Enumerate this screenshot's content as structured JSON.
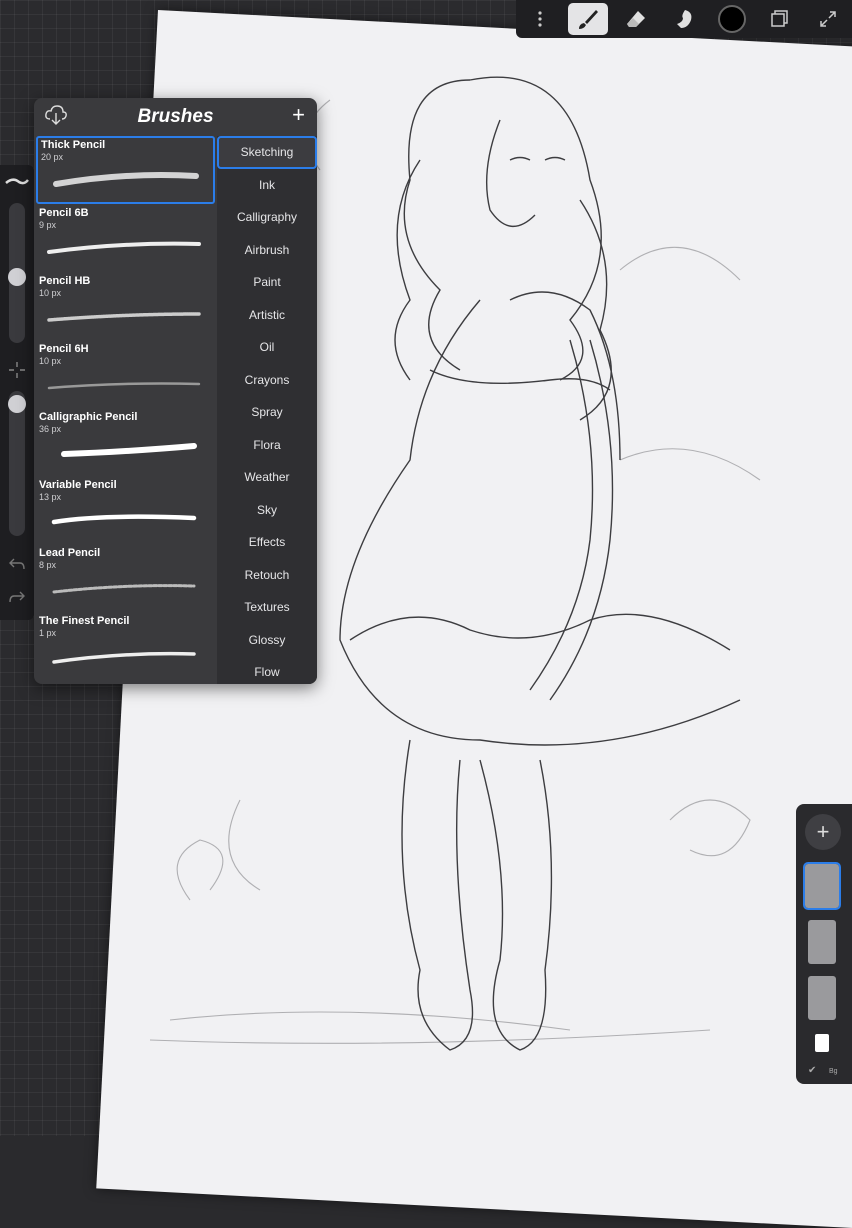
{
  "toolbar": {
    "tools": [
      "more-menu",
      "brush",
      "eraser",
      "smudge",
      "color",
      "layers",
      "fullscreen"
    ],
    "active_tool": "brush",
    "color": "#000000"
  },
  "brush_panel": {
    "title": "Brushes",
    "brushes": [
      {
        "name": "Thick Pencil",
        "size": "20 px"
      },
      {
        "name": "Pencil 6B",
        "size": "9 px"
      },
      {
        "name": "Pencil HB",
        "size": "10 px"
      },
      {
        "name": "Pencil 6H",
        "size": "10 px"
      },
      {
        "name": "Calligraphic Pencil",
        "size": "36 px"
      },
      {
        "name": "Variable Pencil",
        "size": "13 px"
      },
      {
        "name": "Lead Pencil",
        "size": "8 px"
      },
      {
        "name": "The Finest Pencil",
        "size": "1 px"
      }
    ],
    "categories": [
      "Sketching",
      "Ink",
      "Calligraphy",
      "Airbrush",
      "Paint",
      "Artistic",
      "Oil",
      "Crayons",
      "Spray",
      "Flora",
      "Weather",
      "Sky",
      "Effects",
      "Retouch",
      "Textures",
      "Glossy",
      "Flow"
    ]
  },
  "layers": {
    "background_label": "Bg"
  },
  "colors": {
    "accent": "#2b7de9",
    "panel": "#3a3a3d",
    "paper": "#f1f1f3"
  }
}
